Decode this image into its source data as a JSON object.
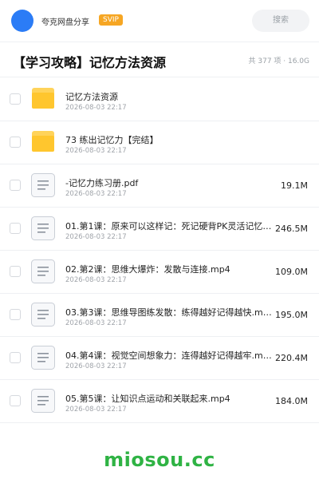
{
  "header": {
    "share_label": "夸克网盘分享",
    "svip_badge": "SVIP",
    "search_placeholder": "搜索"
  },
  "folder": {
    "title": "【学习攻略】记忆方法资源",
    "meta": "共 377 项 · 16.0G"
  },
  "files": [
    {
      "name": "记忆方法资源",
      "date": "2026-08-03 22:17",
      "size": "",
      "type": "folder"
    },
    {
      "name": "73 练出记忆力【完结】",
      "date": "2026-08-03 22:17",
      "size": "",
      "type": "folder"
    },
    {
      "name": "-记忆力练习册.pdf",
      "date": "2026-08-03 22:17",
      "size": "19.1M",
      "type": "file"
    },
    {
      "name": "01.第1课：原来可以这样记：死记硬背PK灵活记忆…",
      "date": "2026-08-03 22:17",
      "size": "246.5M",
      "type": "file"
    },
    {
      "name": "02.第2课：思维大爆炸：发散与连接.mp4",
      "date": "2026-08-03 22:17",
      "size": "109.0M",
      "type": "file"
    },
    {
      "name": "03.第3课：思维导图练发散：练得越好记得越快.m…",
      "date": "2026-08-03 22:17",
      "size": "195.0M",
      "type": "file"
    },
    {
      "name": "04.第4课：视觉空间想象力：连得越好记得越牢.m…",
      "date": "2026-08-03 22:17",
      "size": "220.4M",
      "type": "file"
    },
    {
      "name": "05.第5课：让知识点运动和关联起来.mp4",
      "date": "2026-08-03 22:17",
      "size": "184.0M",
      "type": "file"
    }
  ],
  "watermark": "miosou.cc",
  "colors": {
    "accent": "#2b7cf6",
    "svip": "#f6a623",
    "folder": "#ffc62e",
    "watermark": "#2fb344"
  },
  "icons": {
    "folder": "folder-icon",
    "file": "document-icon"
  }
}
